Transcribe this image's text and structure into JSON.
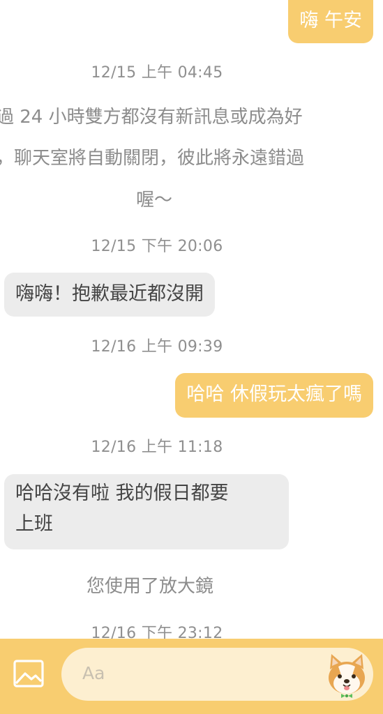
{
  "messages": [
    {
      "from": "me",
      "text": "嗨 午安"
    },
    {
      "time": "12/15 上午 04:45"
    },
    {
      "system": [
        "過 24 小時雙方都沒有新訊息或成為好",
        "，聊天室將自動關閉，彼此將永遠錯過",
        "喔～"
      ]
    },
    {
      "time": "12/15 下午 20:06"
    },
    {
      "from": "them",
      "text": "嗨嗨！抱歉最近都沒開"
    },
    {
      "time": "12/16 上午 09:39"
    },
    {
      "from": "me",
      "text": "哈哈 休假玩太瘋了嗎"
    },
    {
      "time": "12/16 上午 11:18"
    },
    {
      "from": "them",
      "text": [
        "哈哈沒有啦 我的假日都要",
        "上班"
      ]
    },
    {
      "system": "您使用了放大鏡"
    },
    {
      "time": "12/16 下午 23:12"
    }
  ],
  "composer": {
    "placeholder": "Aa",
    "image_icon": "image-icon",
    "sticker_icon": "shiba-dog-icon"
  },
  "colors": {
    "accent": "#f8cd70",
    "input_bg": "#fdefd0",
    "incoming_bubble": "#ececec",
    "timestamp": "#8f8f8f"
  }
}
